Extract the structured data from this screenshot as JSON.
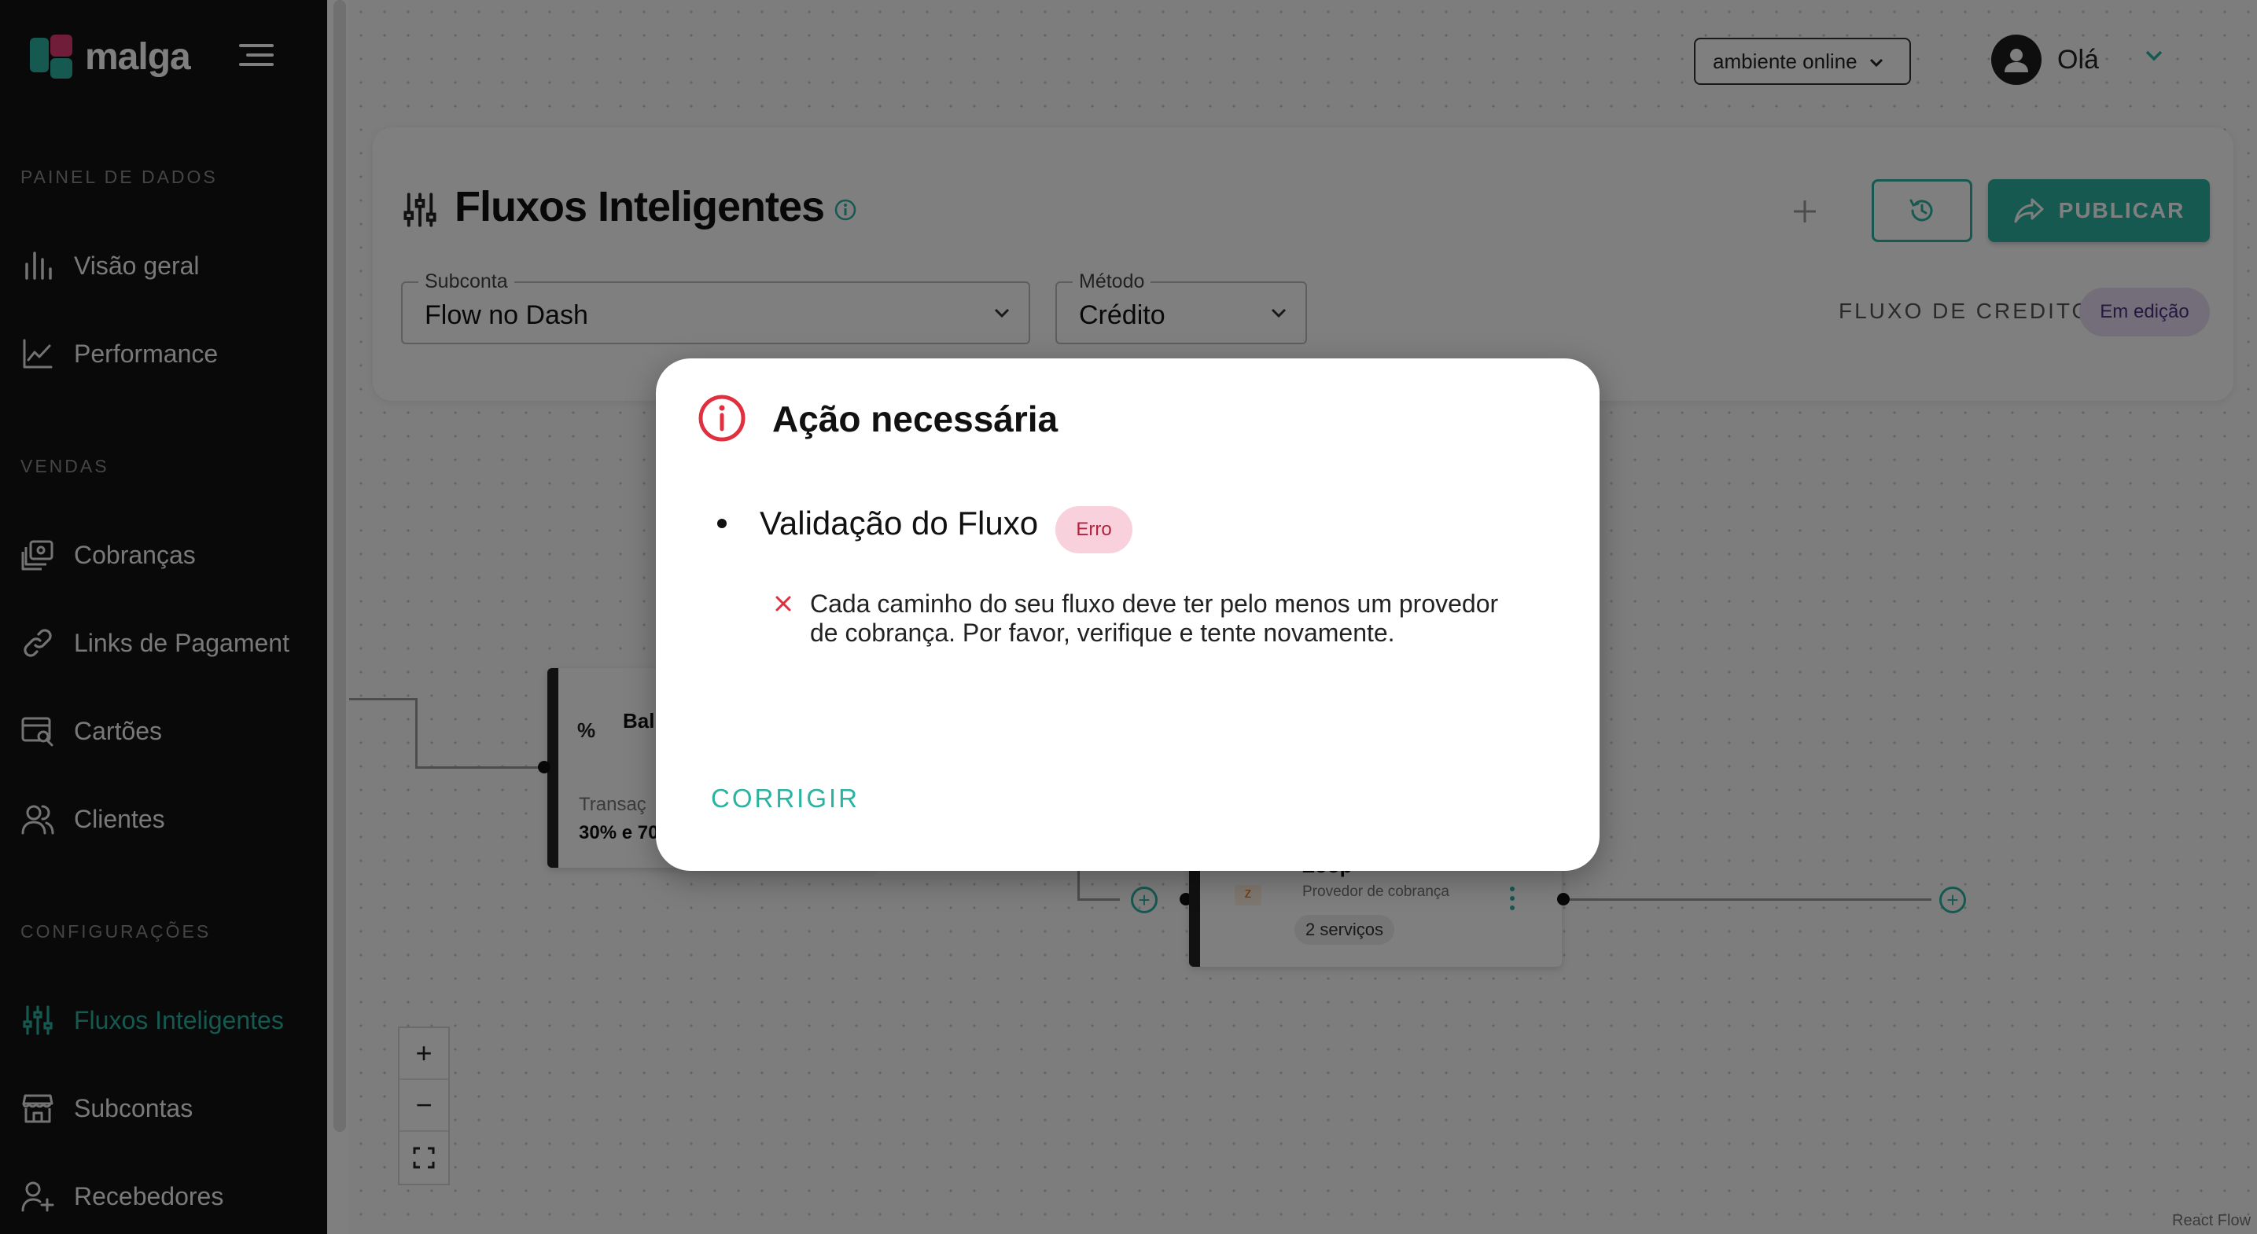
{
  "brand": {
    "name": "malga"
  },
  "sidebar": {
    "sections": [
      {
        "title": "PAINEL DE DADOS"
      },
      {
        "title": "VENDAS"
      },
      {
        "title": "CONFIGURAÇÕES"
      }
    ],
    "items": [
      {
        "label": "Visão geral",
        "icon": "bar-chart-icon"
      },
      {
        "label": "Performance",
        "icon": "line-chart-icon"
      },
      {
        "label": "Cobranças",
        "icon": "charges-icon"
      },
      {
        "label": "Links de Pagament",
        "icon": "link-icon"
      },
      {
        "label": "Cartões",
        "icon": "card-search-icon"
      },
      {
        "label": "Clientes",
        "icon": "users-icon"
      },
      {
        "label": "Fluxos Inteligentes",
        "icon": "sliders-icon",
        "active": true
      },
      {
        "label": "Subcontas",
        "icon": "store-icon"
      },
      {
        "label": "Recebedores",
        "icon": "user-plus-icon"
      }
    ]
  },
  "header": {
    "environment": "ambiente online",
    "greeting": "Olá"
  },
  "page": {
    "title": "Fluxos Inteligentes",
    "publish_label": "PUBLICAR",
    "subaccount": {
      "label": "Subconta",
      "value": "Flow no Dash"
    },
    "method": {
      "label": "Método",
      "value": "Crédito"
    },
    "flow_name": "FLUXO DE CREDITO",
    "status": "Em edição"
  },
  "canvas": {
    "node_balance": {
      "title": "Bal",
      "subtitle": "Transaç",
      "detail": "30% e 70"
    },
    "node_provider": {
      "title": "Zoop",
      "subtitle": "Provedor de cobrança",
      "services": "2 serviços"
    },
    "attribution": "React Flow"
  },
  "modal": {
    "title": "Ação necessária",
    "section": "Validação do Fluxo",
    "badge": "Erro",
    "message": "Cada caminho do seu fluxo deve ter pelo menos um provedor de cobrança. Por favor, verifique e tente novamente.",
    "action": "CORRIGIR"
  },
  "colors": {
    "accent": "#2bb3a2",
    "sidebar_bg": "#121212",
    "error": "#e0303f",
    "error_chip_bg": "#f9d1dc",
    "status_chip_bg": "#e6dcf5"
  }
}
